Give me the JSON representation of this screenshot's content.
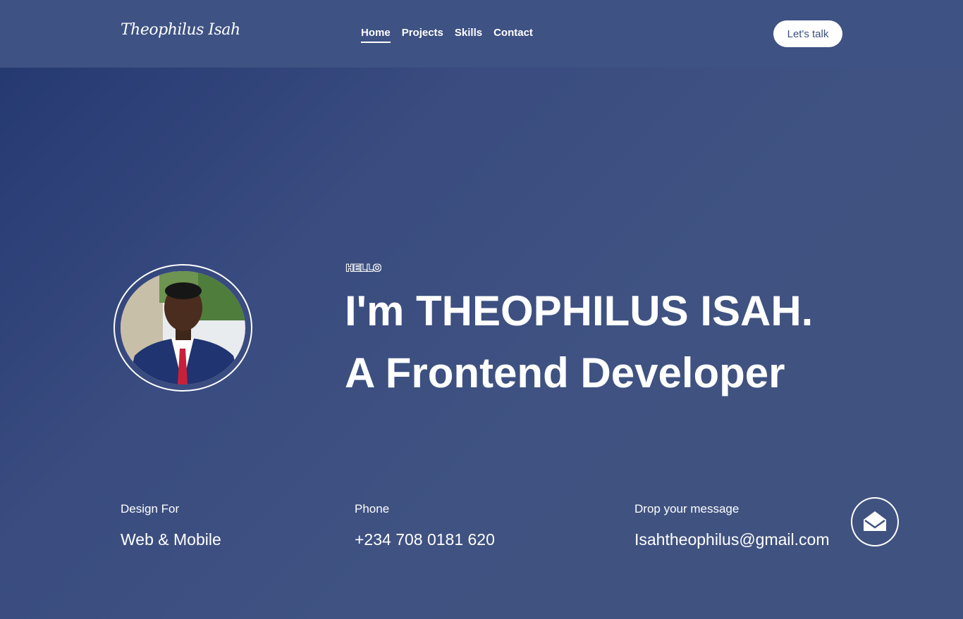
{
  "header": {
    "brand": "Theophilus Isah",
    "nav": [
      {
        "label": "Home"
      },
      {
        "label": "Projects"
      },
      {
        "label": "Skills"
      },
      {
        "label": "Contact"
      }
    ],
    "cta_label": "Let's talk"
  },
  "hero": {
    "greeting": "HELLO",
    "headline_line1": "I'm THEOPHILUS ISAH.",
    "headline_line2": "A Frontend Developer"
  },
  "info": {
    "design_label": "Design For",
    "design_value": "Web & Mobile",
    "phone_label": "Phone",
    "phone_value": "+234 708 0181 620",
    "message_label": "Drop your message",
    "email_value": "Isahtheophilus@gmail.com"
  },
  "icons": {
    "mail": "envelope-open-icon"
  },
  "colors": {
    "accent": "#3c4f7e",
    "background": "#3f5281"
  }
}
